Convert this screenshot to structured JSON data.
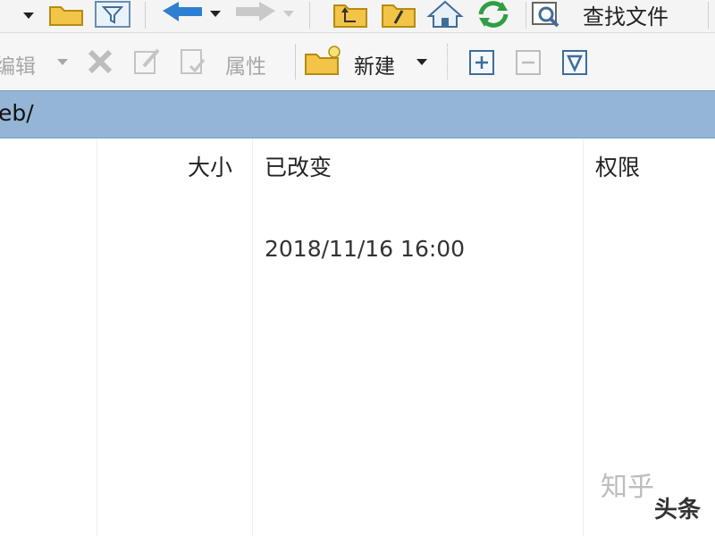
{
  "toolbar": {
    "find_files_label": "查找文件",
    "edit_label": "编辑",
    "properties_label": "属性",
    "new_label": "新建"
  },
  "path": {
    "text": "eb/"
  },
  "columns": {
    "size": "大小",
    "modified": "已改变",
    "permissions": "权限"
  },
  "rows": [
    {
      "modified": "2018/11/16 16:00"
    }
  ],
  "watermark": {
    "zhihu": "知乎",
    "toutiao": "头条"
  },
  "colors": {
    "pathbar": "#94b5d6",
    "folder": "#f2c447",
    "nav_blue": "#2d7fd1",
    "refresh_green": "#2f9e44"
  }
}
